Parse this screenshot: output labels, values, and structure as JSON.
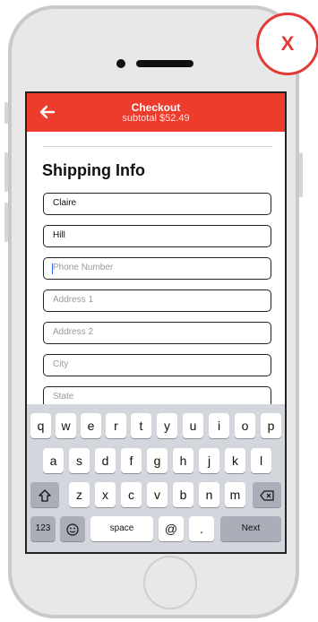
{
  "close_badge": {
    "label": "X"
  },
  "header": {
    "title": "Checkout",
    "subtitle": "subtotal $52.49",
    "back_icon": "arrow-left-icon",
    "color": "#ed3b2c"
  },
  "section": {
    "title": "Shipping Info"
  },
  "fields": {
    "first_name": {
      "value": "Claire"
    },
    "last_name": {
      "value": "Hill"
    },
    "phone": {
      "placeholder": "Phone Number"
    },
    "address1": {
      "placeholder": "Address 1"
    },
    "address2": {
      "placeholder": "Address 2"
    },
    "city": {
      "placeholder": "City"
    },
    "state": {
      "placeholder": "State"
    }
  },
  "keyboard": {
    "row1": [
      "q",
      "w",
      "e",
      "r",
      "t",
      "y",
      "u",
      "i",
      "o",
      "p"
    ],
    "row2": [
      "a",
      "s",
      "d",
      "f",
      "g",
      "h",
      "j",
      "k",
      "l"
    ],
    "row3": [
      "z",
      "x",
      "c",
      "v",
      "b",
      "n",
      "m"
    ],
    "shift_icon": "shift-icon",
    "backspace_icon": "backspace-icon",
    "numbers": "123",
    "emoji_icon": "emoji-icon",
    "space": "space",
    "at": "@",
    "period": ".",
    "next": "Next"
  }
}
